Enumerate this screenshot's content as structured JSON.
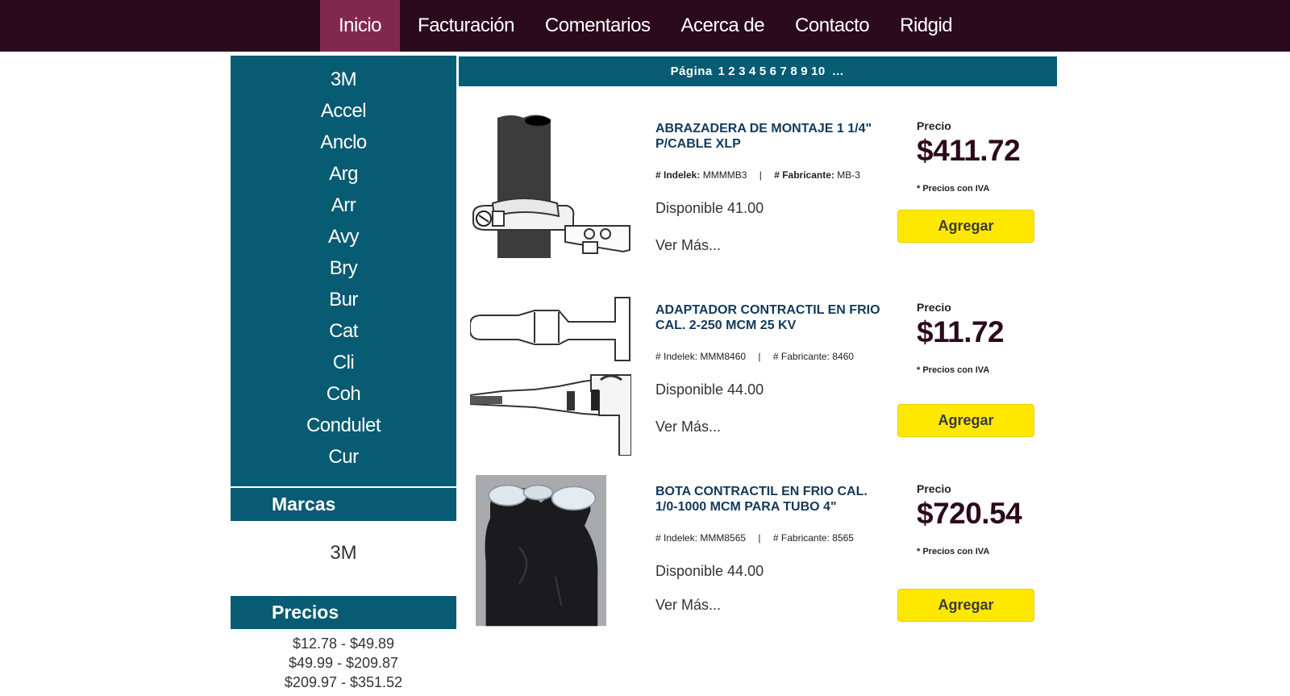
{
  "nav": {
    "items": [
      "Inicio",
      "Facturación",
      "Comentarios",
      "Acerca de",
      "Contacto",
      "Ridgid"
    ],
    "active": "Inicio"
  },
  "sidebar": {
    "categories": [
      "3M",
      "Accel",
      "Anclo",
      "Arg",
      "Arr",
      "Avy",
      "Bry",
      "Bur",
      "Cat",
      "Cli",
      "Coh",
      "Condulet",
      "Cur"
    ],
    "brands_title": "Marcas",
    "brands": [
      "3M"
    ],
    "prices_title": "Precios",
    "price_ranges": [
      "$12.78 - $49.89",
      "$49.99 - $209.87",
      "$209.97 - $351.52"
    ]
  },
  "pager": {
    "label": "Página",
    "pages": [
      "1",
      "2",
      "3",
      "4",
      "5",
      "6",
      "7",
      "8",
      "9",
      "10"
    ],
    "ellipsis": "..."
  },
  "labels": {
    "indelek": "# Indelek:",
    "fabricante": "# Fabricante:",
    "price_label": "Precio",
    "iva_note": "* Precios con IVA",
    "add_button": "Agregar",
    "more_link": "Ver Más..."
  },
  "products": [
    {
      "title": "ABRAZADERA DE MONTAJE 1 1/4\" P/CABLE XLP",
      "indelek": "MMMMB3",
      "fabricante": "MB-3",
      "availability": "Disponible 41.00",
      "price": "$411.72",
      "image": "clamp-image"
    },
    {
      "title": "ADAPTADOR CONTRACTIL EN FRIO CAL. 2-250 MCM 25 KV",
      "indelek": "MMM8460",
      "fabricante": "8460",
      "availability": "Disponible 44.00",
      "price": "$11.72",
      "image": "adapter-image"
    },
    {
      "title": "BOTA CONTRACTIL EN FRIO CAL. 1/0-1000 MCM PARA TUBO 4\"",
      "indelek": "MMM8565",
      "fabricante": "8565",
      "availability": "Disponible 44.00",
      "price": "$720.54",
      "image": "boot-image"
    }
  ],
  "colors": {
    "topbar": "#2b0a1d",
    "nav_active": "#82284e",
    "teal": "#075b72",
    "title_blue": "#12395a",
    "button_yellow": "#ffe800"
  }
}
